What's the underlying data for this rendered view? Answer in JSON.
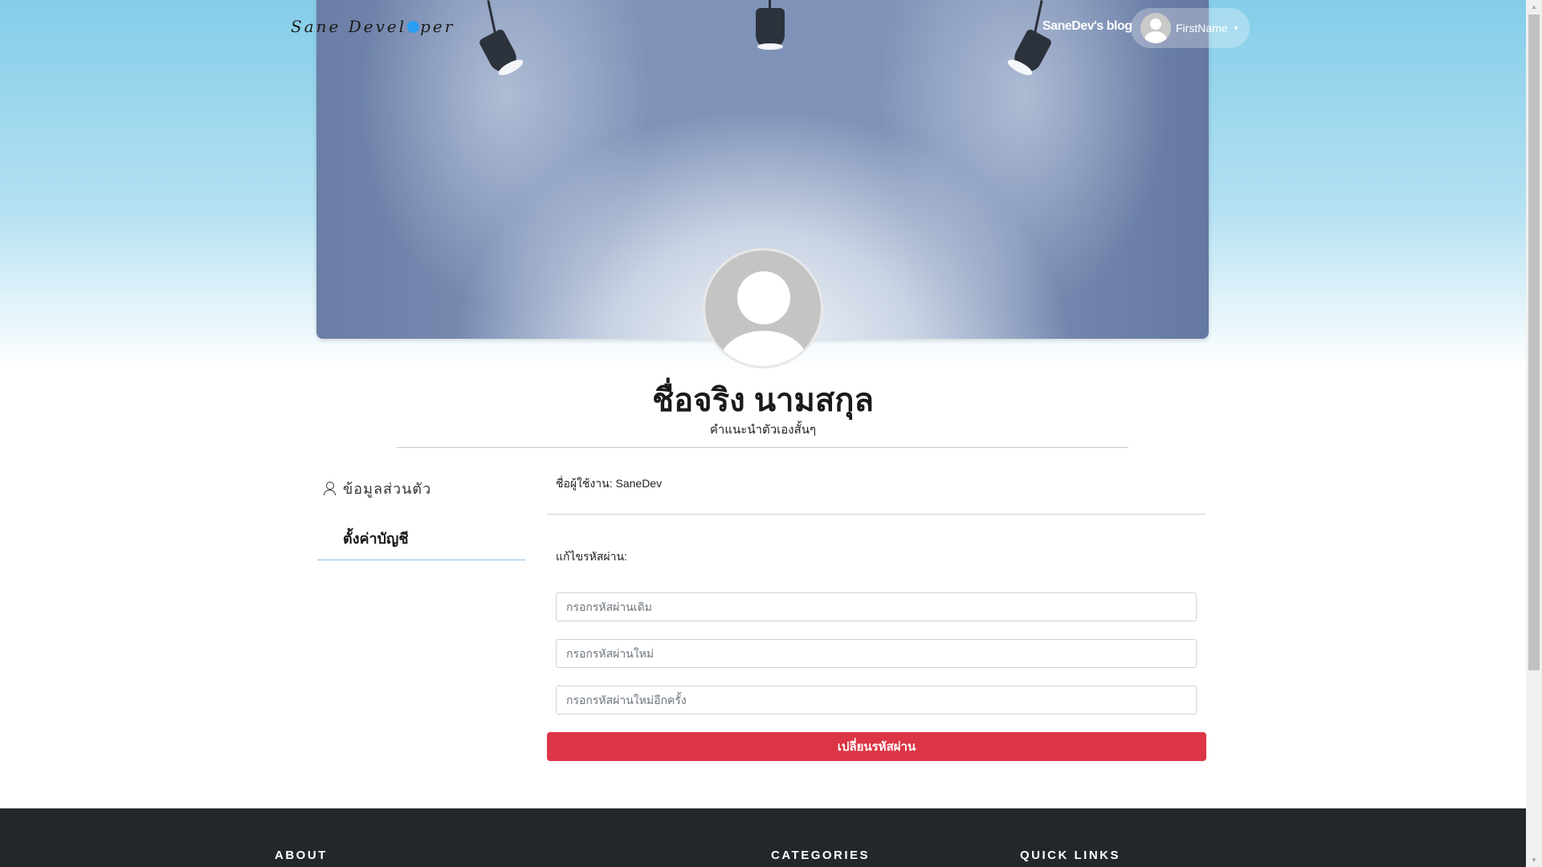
{
  "header": {
    "logo_text": "Sane Devel",
    "logo_text_end": "per",
    "blog_link": "SaneDev's blog",
    "user_name": "FirstName",
    "caret": "▾"
  },
  "profile": {
    "full_name": "ชื่อจริง นามสกุล",
    "bio": "คำแนะนำตัวเองสั้นๆ"
  },
  "sidebar": {
    "personal_info": "ข้อมูลส่วนตัว",
    "account_settings": "ตั้งค่าบัญชี"
  },
  "account": {
    "username_label": "ชื่อผู้ใช้งาน:",
    "username_value": "SaneDev",
    "username_row": "ชื่อผู้ใช้งาน: SaneDev",
    "edit_password_label": "แก้ไขรหัสผ่าน:",
    "old_password_placeholder": "กรอกรหัสผ่านเดิม",
    "new_password_placeholder": "กรอกรหัสผ่านใหม่",
    "confirm_password_placeholder": "กรอกรหัสผ่านใหม่อีกครั้ง",
    "submit_label": "เปลี่ยนรหัสผ่าน",
    "submit_color": "#dc3545"
  },
  "footer": {
    "about": "ABOUT",
    "categories": "CATEGORIES",
    "quick_links": "QUICK LINKS"
  },
  "colors": {
    "footer_bg": "#23272b",
    "accent_underline": "#8fbfe6"
  }
}
